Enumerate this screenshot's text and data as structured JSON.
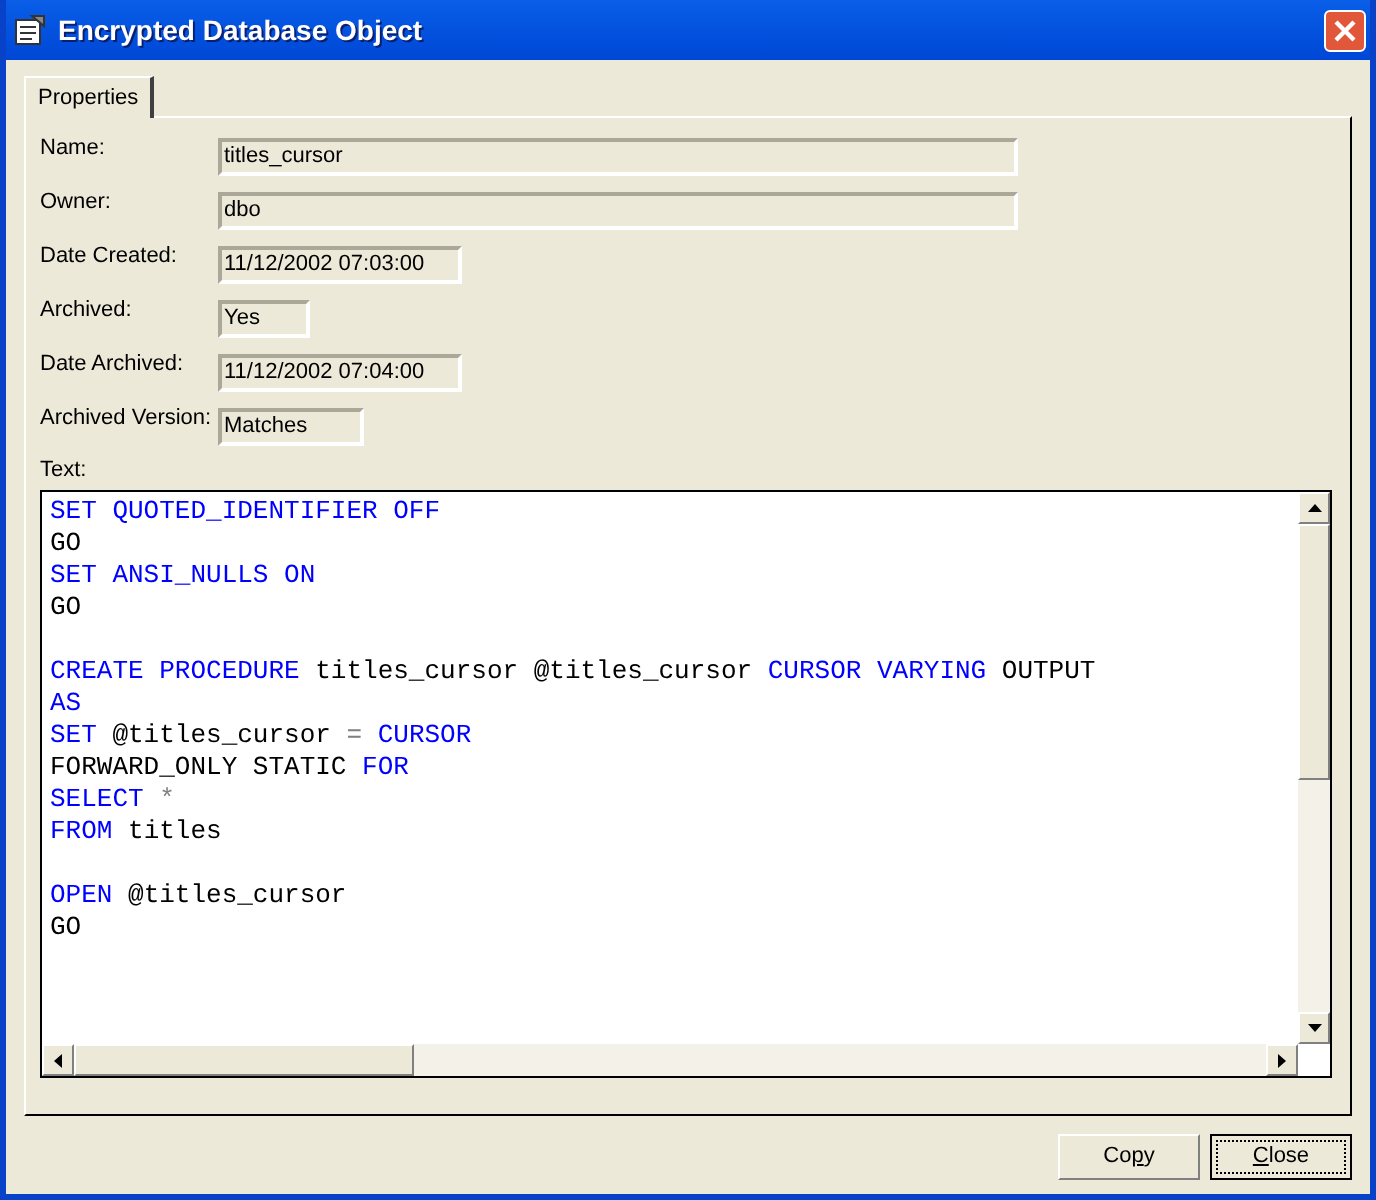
{
  "window": {
    "title": "Encrypted Database Object"
  },
  "tabs": [
    {
      "label": "Properties",
      "selected": true
    }
  ],
  "fields": [
    {
      "label": "Name:",
      "value": "titles_cursor"
    },
    {
      "label": "Owner:",
      "value": "dbo"
    },
    {
      "label": "Date Created:",
      "value": "11/12/2002 07:03:00"
    },
    {
      "label": "Archived:",
      "value": "Yes"
    },
    {
      "label": "Date Archived:",
      "value": "11/12/2002 07:04:00"
    },
    {
      "label": "Archived Version:",
      "value": "Matches"
    }
  ],
  "text_label": "Text:",
  "code_lines": [
    {
      "kind": "code",
      "tokens": [
        {
          "kind": "keyword",
          "text": "SET QUOTED_IDENTIFIER OFF"
        }
      ]
    },
    {
      "kind": "code",
      "tokens": [
        {
          "kind": "plain",
          "text": "GO"
        }
      ]
    },
    {
      "kind": "code",
      "tokens": [
        {
          "kind": "keyword",
          "text": "SET ANSI_NULLS ON"
        }
      ]
    },
    {
      "kind": "code",
      "tokens": [
        {
          "kind": "plain",
          "text": "GO"
        }
      ]
    },
    {
      "kind": "blank"
    },
    {
      "kind": "code",
      "tokens": [
        {
          "kind": "keyword",
          "text": "CREATE PROCEDURE"
        },
        {
          "kind": "plain",
          "text": " titles_cursor @titles_cursor "
        },
        {
          "kind": "keyword",
          "text": "CURSOR VARYING"
        },
        {
          "kind": "plain",
          "text": " OUTPUT"
        }
      ]
    },
    {
      "kind": "code",
      "tokens": [
        {
          "kind": "keyword",
          "text": "AS"
        }
      ]
    },
    {
      "kind": "code",
      "tokens": [
        {
          "kind": "keyword",
          "text": "SET"
        },
        {
          "kind": "plain",
          "text": " @titles_cursor "
        },
        {
          "kind": "operator",
          "text": "="
        },
        {
          "kind": "keyword",
          "text": " CURSOR"
        }
      ]
    },
    {
      "kind": "code",
      "tokens": [
        {
          "kind": "plain",
          "text": "FORWARD_ONLY STATIC "
        },
        {
          "kind": "keyword",
          "text": "FOR"
        }
      ]
    },
    {
      "kind": "code",
      "tokens": [
        {
          "kind": "keyword",
          "text": "SELECT"
        },
        {
          "kind": "operator",
          "text": " *"
        }
      ]
    },
    {
      "kind": "code",
      "tokens": [
        {
          "kind": "keyword",
          "text": "FROM"
        },
        {
          "kind": "plain",
          "text": " titles"
        }
      ]
    },
    {
      "kind": "blank"
    },
    {
      "kind": "code",
      "tokens": [
        {
          "kind": "keyword",
          "text": "OPEN"
        },
        {
          "kind": "plain",
          "text": " @titles_cursor"
        }
      ]
    },
    {
      "kind": "code",
      "tokens": [
        {
          "kind": "plain",
          "text": "GO"
        }
      ]
    }
  ],
  "buttons": [
    {
      "label_parts": [
        {
          "text": "Co",
          "underlined": false
        },
        {
          "text": "p",
          "underlined": true
        },
        {
          "text": "y",
          "underlined": false
        }
      ],
      "default": false
    },
    {
      "label_parts": [
        {
          "text": "C",
          "underlined": true
        },
        {
          "text": "lose",
          "underlined": false
        }
      ],
      "default": true
    }
  ]
}
